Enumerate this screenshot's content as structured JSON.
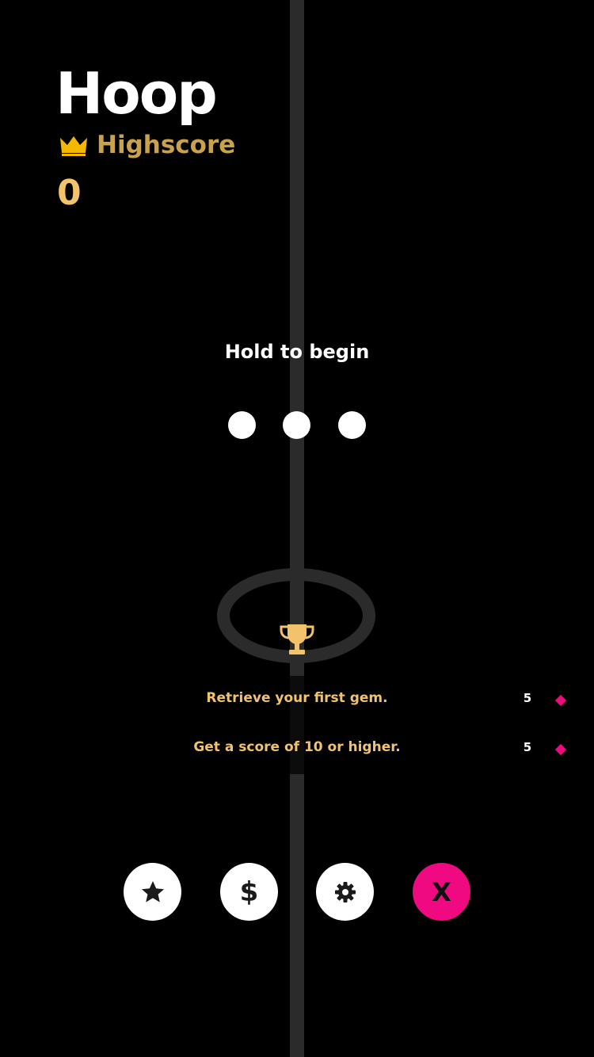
{
  "header": {
    "title": "Hoop",
    "highscore_label": "Highscore",
    "highscore_value": "0",
    "crown_icon": "crown-icon"
  },
  "prompt": {
    "text": "Hold to begin",
    "dot_count": 3
  },
  "achievements": [
    {
      "text": "Retrieve your first gem.",
      "reward": "5",
      "icon": "gem-icon"
    },
    {
      "text": "Get a score of 10 or higher.",
      "reward": "5",
      "icon": "gem-icon"
    }
  ],
  "buttons": [
    {
      "name": "rate-button",
      "icon": "star-icon"
    },
    {
      "name": "shop-button",
      "label": "$",
      "icon": "dollar-icon"
    },
    {
      "name": "settings-button",
      "icon": "gear-icon"
    },
    {
      "name": "close-button",
      "label": "X",
      "icon": "close-icon"
    }
  ],
  "colors": {
    "background": "#000000",
    "pole": "#2b2b2b",
    "gold": "#f2c36b",
    "highscore_label": "#c9a24a",
    "accent_pink": "#f00a82",
    "button_white": "#ffffff"
  }
}
